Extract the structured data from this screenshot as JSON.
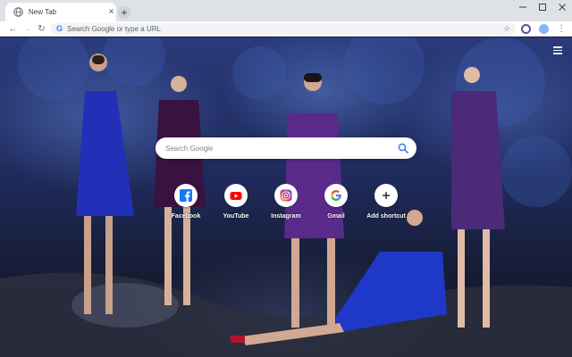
{
  "tab": {
    "title": "New Tab",
    "close_glyph": "×",
    "icon": "globe-icon"
  },
  "newtab": {
    "glyph": "+"
  },
  "toolbar": {
    "back": "←",
    "forward": "→",
    "reload": "↻",
    "omnibox_placeholder": "Search Google or type a URL",
    "omnibox_logo": "G",
    "star": "☆",
    "kebab": "⋮"
  },
  "search": {
    "placeholder": "Search Google"
  },
  "shortcuts": [
    {
      "label": "Facebook",
      "icon": "facebook-icon",
      "color": "#1877f2"
    },
    {
      "label": "YouTube",
      "icon": "youtube-icon",
      "color": "#ff0000"
    },
    {
      "label": "Instagram",
      "icon": "instagram-icon",
      "color": "#c13584"
    },
    {
      "label": "Gmail",
      "icon": "google-icon",
      "color": "#4285f4"
    },
    {
      "label": "Add shortcut",
      "icon": "add-icon",
      "color": "#202124"
    }
  ],
  "colors": {
    "tabstrip": "#dee1e6",
    "toolbar": "#ffffff",
    "omnibox": "#f1f3f4"
  }
}
